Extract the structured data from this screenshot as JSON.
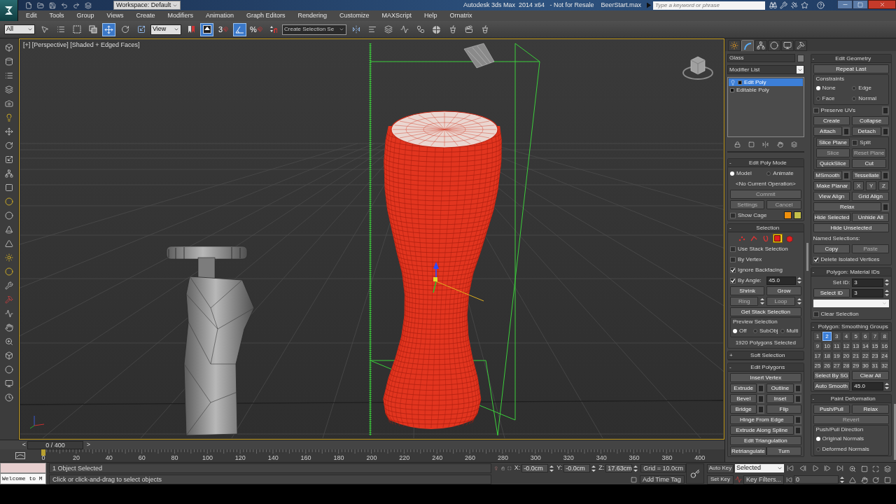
{
  "title_bar": {
    "workspace": "Workspace: Default",
    "title": "Autodesk 3ds Max  2014 x64   - Not for Resale    BeerStart.max",
    "search": {
      "placeholder": "Type a keyword or phrase"
    }
  },
  "menu": [
    "Edit",
    "Tools",
    "Group",
    "Views",
    "Create",
    "Modifiers",
    "Animation",
    "Graph Editors",
    "Rendering",
    "Customize",
    "MAXScript",
    "Help",
    "Ornatrix"
  ],
  "toolbar": {
    "selection_filter": "All",
    "reference_coord": "View",
    "named_selection": "Create Selection Se",
    "tools": [
      {
        "kind": "select",
        "selected": false
      },
      {
        "kind": "select-by-name",
        "selected": false
      },
      {
        "kind": "region",
        "selected": false
      },
      {
        "kind": "crossing",
        "selected": false
      },
      {
        "kind": "move",
        "selected": true
      },
      {
        "kind": "rotate",
        "selected": false
      },
      {
        "kind": "scale",
        "selected": false
      },
      {
        "kind": "ref-dropdown",
        "selected": false
      },
      {
        "kind": "pivot",
        "selected": false
      },
      {
        "kind": "manipulate",
        "selected": true
      },
      {
        "kind": "snap",
        "label": "3",
        "selected": false
      },
      {
        "kind": "angle-snap",
        "selected": true
      },
      {
        "kind": "percent-snap",
        "label": "%",
        "selected": false
      },
      {
        "kind": "spinner-snap",
        "selected": false
      },
      {
        "kind": "named-dropdown",
        "selected": false
      },
      {
        "kind": "mirror",
        "selected": false
      },
      {
        "kind": "align",
        "selected": false
      },
      {
        "kind": "layers",
        "selected": false
      },
      {
        "kind": "curve-editor",
        "selected": false
      },
      {
        "kind": "schematic",
        "selected": false
      },
      {
        "kind": "material",
        "selected": false
      },
      {
        "kind": "render-setup",
        "selected": false
      },
      {
        "kind": "render-frame",
        "selected": false
      },
      {
        "kind": "render",
        "selected": false
      }
    ]
  },
  "viewport": {
    "label": "[+] [Perspective] [Shaded + Edged Faces]",
    "active": true
  },
  "command_panel": {
    "tabs": [
      {
        "kind": "create",
        "selected": false
      },
      {
        "kind": "modify",
        "selected": true
      },
      {
        "kind": "hierarchy",
        "selected": false
      },
      {
        "kind": "motion",
        "selected": false
      },
      {
        "kind": "display",
        "selected": false
      },
      {
        "kind": "utilities",
        "selected": false
      }
    ],
    "object_name": "Glass",
    "modifier_list": "Modifier List",
    "stack": [
      {
        "kind": "modifier",
        "label": "Edit Poly",
        "selected": true
      },
      {
        "kind": "base",
        "label": "Editable Poly",
        "selected": false
      }
    ],
    "left_rollouts": [
      {
        "sign": "-",
        "title": "Edit Poly Mode",
        "rows": [
          [
            {
              "kind": "radio",
              "label": "Model",
              "selected": true
            },
            {
              "kind": "radio",
              "label": "Animate",
              "selected": false
            }
          ],
          [
            {
              "kind": "text",
              "label": "<No Current Operation>"
            }
          ],
          [
            {
              "kind": "button",
              "label": "Commit",
              "disabled": true,
              "settings": false
            }
          ],
          [
            {
              "kind": "button",
              "label": "Settings",
              "disabled": true,
              "settings": false
            },
            {
              "kind": "button",
              "label": "Cancel",
              "disabled": true,
              "settings": false
            }
          ],
          [
            {
              "kind": "check",
              "label": "Show Cage",
              "checked": false
            },
            {
              "kind": "swatch",
              "color": "#f0900c"
            },
            {
              "kind": "swatch",
              "color": "#c4c04a"
            }
          ]
        ]
      },
      {
        "sign": "-",
        "title": "Selection",
        "rows": [
          [
            {
              "kind": "subobj",
              "levels": [
                {
                  "kind": "vertex",
                  "selected": false
                },
                {
                  "kind": "edge",
                  "selected": false
                },
                {
                  "kind": "border",
                  "selected": false
                },
                {
                  "kind": "polygon",
                  "selected": true
                },
                {
                  "kind": "element",
                  "selected": false
                }
              ]
            }
          ],
          [
            {
              "kind": "check",
              "label": "Use Stack Selection",
              "checked": false
            }
          ],
          [
            {
              "kind": "check",
              "label": "By Vertex",
              "checked": false
            }
          ],
          [
            {
              "kind": "check",
              "label": "Ignore Backfacing",
              "checked": true
            }
          ],
          [
            {
              "kind": "check",
              "label": "By Angle:",
              "checked": true
            },
            {
              "kind": "spinner",
              "value": "45.0"
            }
          ],
          [
            {
              "kind": "button",
              "label": "Shrink",
              "disabled": false,
              "settings": false
            },
            {
              "kind": "button",
              "label": "Grow",
              "disabled": false,
              "settings": false
            }
          ],
          [
            {
              "kind": "button",
              "label": "Ring",
              "disabled": true,
              "settings": false
            },
            {
              "kind": "spin"
            },
            {
              "kind": "button",
              "label": "Loop",
              "disabled": true,
              "settings": false
            },
            {
              "kind": "spin"
            }
          ],
          [
            {
              "kind": "button",
              "label": "Get Stack Selection",
              "disabled": false,
              "settings": false
            }
          ],
          [
            {
              "kind": "group",
              "title": "Preview Selection",
              "rows": [
                [
                  {
                    "kind": "radio",
                    "label": "Off",
                    "selected": true
                  },
                  {
                    "kind": "radio",
                    "label": "SubObj",
                    "selected": false
                  },
                  {
                    "kind": "radio",
                    "label": "Multi",
                    "selected": false
                  }
                ]
              ]
            }
          ],
          [
            {
              "kind": "text",
              "label": "1920 Polygons Selected"
            }
          ]
        ]
      },
      {
        "sign": "+",
        "title": "Soft Selection"
      },
      {
        "sign": "-",
        "title": "Edit Polygons",
        "rows": [
          [
            {
              "kind": "button",
              "label": "Insert Vertex",
              "disabled": false,
              "settings": false
            }
          ],
          [
            {
              "kind": "button",
              "label": "Extrude",
              "disabled": false,
              "settings": true
            },
            {
              "kind": "button",
              "label": "Outline",
              "disabled": false,
              "settings": true
            }
          ],
          [
            {
              "kind": "button",
              "label": "Bevel",
              "disabled": false,
              "settings": true
            },
            {
              "kind": "button",
              "label": "Inset",
              "disabled": false,
              "settings": true
            }
          ],
          [
            {
              "kind": "button",
              "label": "Bridge",
              "disabled": false,
              "settings": true
            },
            {
              "kind": "button",
              "label": "Flip",
              "disabled": false,
              "settings": false
            }
          ],
          [
            {
              "kind": "button",
              "label": "Hinge From Edge",
              "disabled": false,
              "settings": true
            }
          ],
          [
            {
              "kind": "button",
              "label": "Extrude Along Spline",
              "disabled": false,
              "settings": true
            }
          ],
          [
            {
              "kind": "button",
              "label": "Edit Triangulation",
              "disabled": false,
              "settings": false
            }
          ],
          [
            {
              "kind": "button",
              "label": "Retriangulate",
              "disabled": false,
              "settings": false
            },
            {
              "kind": "button",
              "label": "Turn",
              "disabled": false,
              "settings": false
            }
          ]
        ]
      }
    ],
    "right_rollouts": [
      {
        "sign": "-",
        "title": "Edit Geometry",
        "rows": [
          [
            {
              "kind": "button",
              "label": "Repeat Last",
              "disabled": false,
              "settings": false
            }
          ],
          [
            {
              "kind": "group",
              "title": "Constraints",
              "rows": [
                [
                  {
                    "kind": "radio",
                    "label": "None",
                    "selected": true
                  },
                  {
                    "kind": "radio",
                    "label": "Edge",
                    "selected": false
                  }
                ],
                [
                  {
                    "kind": "radio",
                    "label": "Face",
                    "selected": false
                  },
                  {
                    "kind": "radio",
                    "label": "Normal",
                    "selected": false
                  }
                ]
              ]
            }
          ],
          [
            {
              "kind": "check",
              "label": "Preserve UVs",
              "checked": false
            },
            {
              "kind": "settings"
            }
          ],
          [
            {
              "kind": "button",
              "label": "Create",
              "disabled": false,
              "settings": false
            },
            {
              "kind": "button",
              "label": "Collapse",
              "disabled": false,
              "settings": false
            }
          ],
          [
            {
              "kind": "button",
              "label": "Attach",
              "disabled": false,
              "settings": true
            },
            {
              "kind": "button",
              "label": "Detach",
              "disabled": false,
              "settings": true
            }
          ],
          [
            {
              "kind": "group",
              "rows": [
                [
                  {
                    "kind": "button",
                    "label": "Slice Plane",
                    "disabled": false,
                    "settings": false
                  },
                  {
                    "kind": "check",
                    "label": "Split",
                    "checked": false
                  }
                ],
                [
                  {
                    "kind": "button",
                    "label": "Slice",
                    "disabled": true,
                    "settings": false
                  },
                  {
                    "kind": "button",
                    "label": "Reset Plane",
                    "disabled": true,
                    "settings": false
                  }
                ],
                [
                  {
                    "kind": "button",
                    "label": "QuickSlice",
                    "disabled": false,
                    "settings": false
                  },
                  {
                    "kind": "button",
                    "label": "Cut",
                    "disabled": false,
                    "settings": false
                  }
                ]
              ]
            }
          ],
          [
            {
              "kind": "button",
              "label": "MSmooth",
              "disabled": false,
              "settings": true
            },
            {
              "kind": "button",
              "label": "Tessellate",
              "disabled": false,
              "settings": true
            }
          ],
          [
            {
              "kind": "button",
              "label": "Make Planar",
              "disabled": false,
              "settings": false
            },
            {
              "kind": "axis_button",
              "label": "X"
            },
            {
              "kind": "axis_button",
              "label": "Y"
            },
            {
              "kind": "axis_button",
              "label": "Z"
            }
          ],
          [
            {
              "kind": "button",
              "label": "View Align",
              "disabled": false,
              "settings": false
            },
            {
              "kind": "button",
              "label": "Grid Align",
              "disabled": false,
              "settings": false
            }
          ],
          [
            {
              "kind": "button",
              "label": "Relax",
              "disabled": false,
              "settings": true
            }
          ],
          [
            {
              "kind": "button",
              "label": "Hide Selected",
              "disabled": false,
              "settings": false
            },
            {
              "kind": "button",
              "label": "Unhide All",
              "disabled": false,
              "settings": false
            }
          ],
          [
            {
              "kind": "button",
              "label": "Hide Unselected",
              "disabled": false,
              "settings": false
            }
          ],
          [
            {
              "kind": "caption",
              "label": "Named Selections:"
            }
          ],
          [
            {
              "kind": "button",
              "label": "Copy",
              "disabled": false,
              "settings": false
            },
            {
              "kind": "button",
              "label": "Paste",
              "disabled": true,
              "settings": false
            }
          ],
          [
            {
              "kind": "check",
              "label": "Delete Isolated Vertices",
              "checked": true
            }
          ]
        ]
      },
      {
        "sign": "-",
        "title": "Polygon: Material IDs",
        "rows": [
          [
            {
              "kind": "label",
              "label": "Set ID:"
            },
            {
              "kind": "spinner",
              "value": "3"
            }
          ],
          [
            {
              "kind": "button",
              "label": "Select ID",
              "disabled": false,
              "settings": false
            },
            {
              "kind": "spinner",
              "value": "3"
            }
          ],
          [
            {
              "kind": "dropdown"
            }
          ],
          [
            {
              "kind": "check",
              "label": "Clear Selection",
              "checked": false
            }
          ]
        ]
      },
      {
        "sign": "-",
        "title": "Polygon: Smoothing Groups",
        "rows": [
          [
            {
              "kind": "sg_grid",
              "groups": [
                {
                  "label": "1",
                  "selected": false
                },
                {
                  "label": "2",
                  "selected": true
                },
                {
                  "label": "3",
                  "selected": false
                },
                {
                  "label": "4",
                  "selected": false
                },
                {
                  "label": "5",
                  "selected": false
                },
                {
                  "label": "6",
                  "selected": false
                },
                {
                  "label": "7",
                  "selected": false
                },
                {
                  "label": "8",
                  "selected": false
                },
                {
                  "label": "9",
                  "selected": false
                },
                {
                  "label": "10",
                  "selected": false
                },
                {
                  "label": "11",
                  "selected": false
                },
                {
                  "label": "12",
                  "selected": false
                },
                {
                  "label": "13",
                  "selected": false
                },
                {
                  "label": "14",
                  "selected": false
                },
                {
                  "label": "15",
                  "selected": false
                },
                {
                  "label": "16",
                  "selected": false
                },
                {
                  "label": "17",
                  "selected": false
                },
                {
                  "label": "18",
                  "selected": false
                },
                {
                  "label": "19",
                  "selected": false
                },
                {
                  "label": "20",
                  "selected": false
                },
                {
                  "label": "21",
                  "selected": false
                },
                {
                  "label": "22",
                  "selected": false
                },
                {
                  "label": "23",
                  "selected": false
                },
                {
                  "label": "24",
                  "selected": false
                },
                {
                  "label": "25",
                  "selected": false
                },
                {
                  "label": "26",
                  "selected": false
                },
                {
                  "label": "27",
                  "selected": false
                },
                {
                  "label": "28",
                  "selected": false
                },
                {
                  "label": "29",
                  "selected": false
                },
                {
                  "label": "30",
                  "selected": false
                },
                {
                  "label": "31",
                  "selected": false
                },
                {
                  "label": "32",
                  "selected": false
                }
              ]
            }
          ],
          [
            {
              "kind": "button",
              "label": "Select By SG",
              "disabled": false,
              "settings": false
            },
            {
              "kind": "button",
              "label": "Clear All",
              "disabled": false,
              "settings": false
            }
          ],
          [
            {
              "kind": "button",
              "label": "Auto Smooth",
              "disabled": false,
              "settings": false
            },
            {
              "kind": "spinner",
              "value": "45.0"
            }
          ]
        ]
      },
      {
        "sign": "-",
        "title": "Paint Deformation",
        "rows": [
          [
            {
              "kind": "button",
              "label": "Push/Pull",
              "disabled": false,
              "settings": false
            },
            {
              "kind": "button",
              "label": "Relax",
              "disabled": false,
              "settings": false
            }
          ],
          [
            {
              "kind": "button",
              "label": "Revert",
              "disabled": true,
              "settings": false
            }
          ],
          [
            {
              "kind": "group",
              "title": "Push/Pull Direction",
              "rows": [
                [
                  {
                    "kind": "radio",
                    "label": "Original Normals",
                    "selected": true
                  }
                ],
                [
                  {
                    "kind": "radio",
                    "label": "Deformed Normals",
                    "selected": false
                  }
                ]
              ]
            }
          ]
        ]
      }
    ]
  },
  "time_slider": {
    "prev": "<",
    "position": "0 / 400",
    "next": ">",
    "level": 0
  },
  "track_bar": {
    "ticks": [
      "0",
      "20",
      "40",
      "60",
      "80",
      "100",
      "120",
      "140",
      "160",
      "180",
      "200",
      "220",
      "240",
      "260",
      "280",
      "300",
      "320",
      "340",
      "360",
      "380",
      "400"
    ]
  },
  "status": {
    "listener": "Welcome to M",
    "selection": "1 Object Selected",
    "prompt": "Click or click-and-drag to select objects",
    "coords": [
      {
        "label": "X:",
        "value": "-0.0cm"
      },
      {
        "label": "Y:",
        "value": "-0.0cm"
      },
      {
        "label": "Z:",
        "value": "17.63cm"
      }
    ],
    "grid": "Grid = 10.0cm",
    "time_tag": "Add Time Tag"
  },
  "animation": {
    "auto_key": "Auto Key",
    "key_mode": "Selected",
    "set_key": "Set Key",
    "key_filters": "Key Filters...",
    "frame": "0"
  }
}
